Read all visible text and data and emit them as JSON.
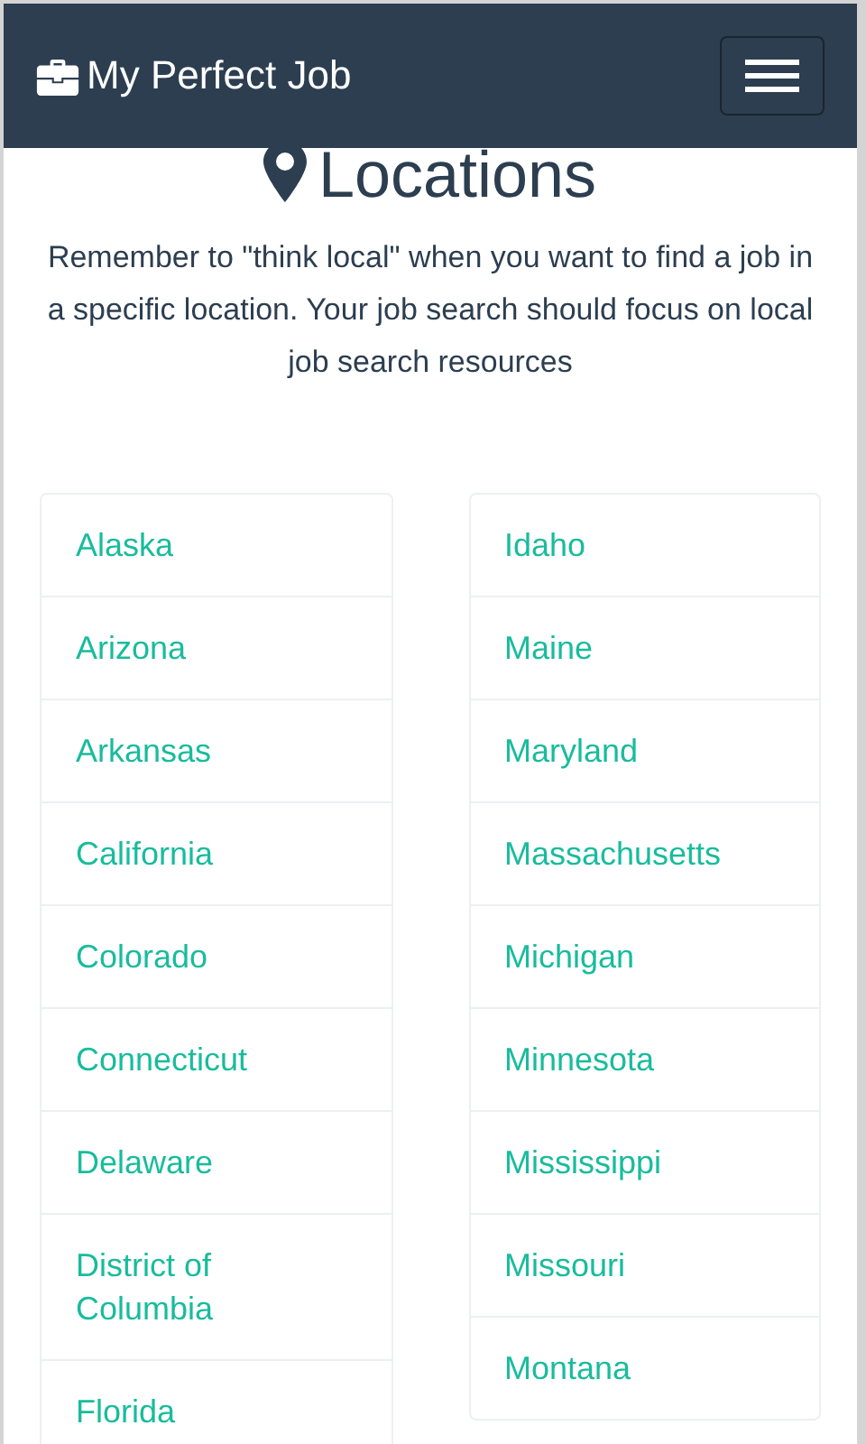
{
  "navbar": {
    "brand": "My Perfect Job"
  },
  "heading": "Locations",
  "intro": "Remember to \"think local\" when you want to find a job in a specific location. Your job search should focus on local job search resources",
  "columns": [
    {
      "items": [
        "Alaska",
        "Arizona",
        "Arkansas",
        "California",
        "Colorado",
        "Connecticut",
        "Delaware",
        "District of Columbia",
        "Florida"
      ]
    },
    {
      "items": [
        "Idaho",
        "Maine",
        "Maryland",
        "Massachusetts",
        "Michigan",
        "Minnesota",
        "Mississippi",
        "Missouri",
        "Montana"
      ]
    }
  ]
}
